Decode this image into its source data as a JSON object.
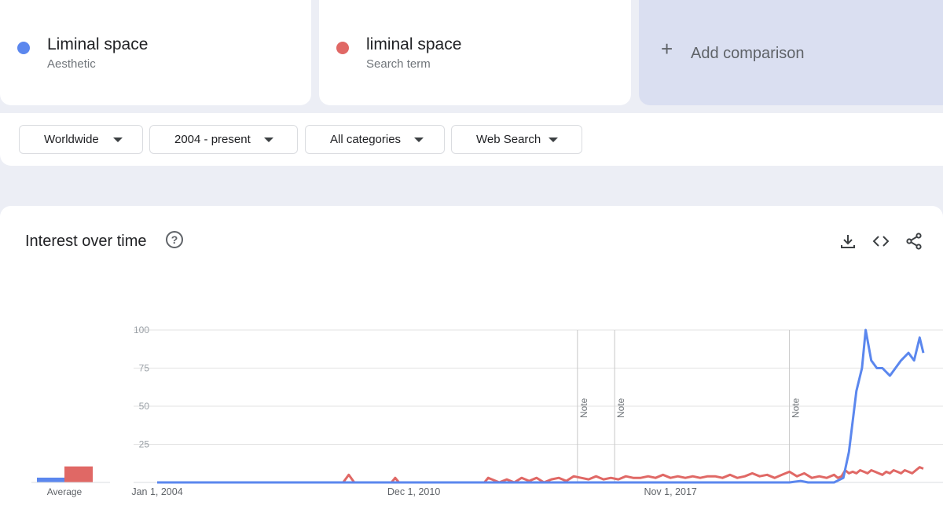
{
  "terms": [
    {
      "label": "Liminal space",
      "type": "Aesthetic",
      "color": "#5b87ee"
    },
    {
      "label": "liminal space",
      "type": "Search term",
      "color": "#e06865"
    }
  ],
  "add_comparison": "Add comparison",
  "filters": {
    "region": "Worldwide",
    "time": "2004 - present",
    "category": "All categories",
    "property": "Web Search"
  },
  "chart_title": "Interest over time",
  "chart_data": {
    "type": "line",
    "x_labels": [
      "Jan 1, 2004",
      "Dec 1, 2010",
      "Nov 1, 2017"
    ],
    "ylim": [
      0,
      100
    ],
    "y_ticks": [
      25,
      50,
      75,
      100
    ],
    "notes": [
      "Note",
      "Note",
      "Note"
    ],
    "average_label": "Average",
    "averages": {
      "Liminal space": 3,
      "liminal space": 10
    },
    "series": [
      {
        "name": "Liminal space",
        "color": "#5b87ee",
        "points": [
          [
            2004.0,
            0
          ],
          [
            2018.9,
            0
          ],
          [
            2021.0,
            0
          ],
          [
            2021.3,
            1
          ],
          [
            2021.5,
            0
          ],
          [
            2022.2,
            0
          ],
          [
            2022.45,
            3
          ],
          [
            2022.6,
            20
          ],
          [
            2022.8,
            60
          ],
          [
            2022.95,
            75
          ],
          [
            2023.05,
            100
          ],
          [
            2023.2,
            80
          ],
          [
            2023.35,
            75
          ],
          [
            2023.5,
            75
          ],
          [
            2023.7,
            70
          ],
          [
            2023.85,
            75
          ],
          [
            2024.0,
            80
          ],
          [
            2024.2,
            85
          ],
          [
            2024.35,
            80
          ],
          [
            2024.5,
            95
          ],
          [
            2024.6,
            85
          ]
        ]
      },
      {
        "name": "liminal space",
        "color": "#e06865",
        "points": [
          [
            2004.0,
            0
          ],
          [
            2009.0,
            0
          ],
          [
            2009.15,
            5
          ],
          [
            2009.3,
            0
          ],
          [
            2010.3,
            0
          ],
          [
            2010.4,
            3
          ],
          [
            2010.5,
            0
          ],
          [
            2012.8,
            0
          ],
          [
            2012.9,
            3
          ],
          [
            2013.0,
            2
          ],
          [
            2013.2,
            0
          ],
          [
            2013.4,
            2
          ],
          [
            2013.6,
            0
          ],
          [
            2013.8,
            3
          ],
          [
            2014.0,
            1
          ],
          [
            2014.2,
            3
          ],
          [
            2014.4,
            0
          ],
          [
            2014.6,
            2
          ],
          [
            2014.8,
            3
          ],
          [
            2015.0,
            1
          ],
          [
            2015.2,
            4
          ],
          [
            2015.4,
            3
          ],
          [
            2015.6,
            2
          ],
          [
            2015.8,
            4
          ],
          [
            2016.0,
            2
          ],
          [
            2016.2,
            3
          ],
          [
            2016.4,
            2
          ],
          [
            2016.6,
            4
          ],
          [
            2016.8,
            3
          ],
          [
            2017.0,
            3
          ],
          [
            2017.2,
            4
          ],
          [
            2017.4,
            3
          ],
          [
            2017.6,
            5
          ],
          [
            2017.8,
            3
          ],
          [
            2018.0,
            4
          ],
          [
            2018.2,
            3
          ],
          [
            2018.4,
            4
          ],
          [
            2018.6,
            3
          ],
          [
            2018.8,
            4
          ],
          [
            2019.0,
            4
          ],
          [
            2019.2,
            3
          ],
          [
            2019.4,
            5
          ],
          [
            2019.6,
            3
          ],
          [
            2019.8,
            4
          ],
          [
            2020.0,
            6
          ],
          [
            2020.2,
            4
          ],
          [
            2020.4,
            5
          ],
          [
            2020.6,
            3
          ],
          [
            2020.8,
            5
          ],
          [
            2021.0,
            7
          ],
          [
            2021.2,
            4
          ],
          [
            2021.4,
            6
          ],
          [
            2021.6,
            3
          ],
          [
            2021.8,
            4
          ],
          [
            2022.0,
            3
          ],
          [
            2022.1,
            4
          ],
          [
            2022.2,
            5
          ],
          [
            2022.3,
            3
          ],
          [
            2022.4,
            4
          ],
          [
            2022.5,
            8
          ],
          [
            2022.6,
            6
          ],
          [
            2022.7,
            7
          ],
          [
            2022.8,
            6
          ],
          [
            2022.9,
            8
          ],
          [
            2023.0,
            7
          ],
          [
            2023.1,
            6
          ],
          [
            2023.2,
            8
          ],
          [
            2023.3,
            7
          ],
          [
            2023.4,
            6
          ],
          [
            2023.5,
            5
          ],
          [
            2023.6,
            7
          ],
          [
            2023.7,
            6
          ],
          [
            2023.8,
            8
          ],
          [
            2023.9,
            7
          ],
          [
            2024.0,
            6
          ],
          [
            2024.1,
            8
          ],
          [
            2024.2,
            7
          ],
          [
            2024.3,
            6
          ],
          [
            2024.4,
            8
          ],
          [
            2024.5,
            10
          ],
          [
            2024.6,
            9
          ]
        ]
      }
    ]
  }
}
